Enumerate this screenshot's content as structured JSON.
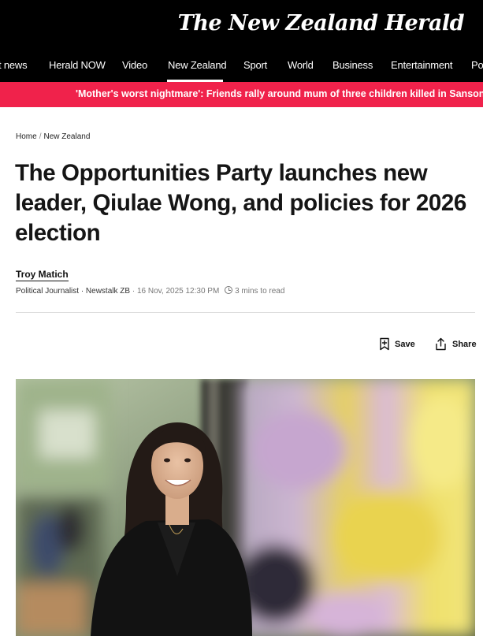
{
  "site": {
    "logo": "The New Zealand Herald"
  },
  "nav": {
    "items": [
      {
        "label": "t news"
      },
      {
        "label": "Herald NOW"
      },
      {
        "label": "Video"
      },
      {
        "label": "New Zealand"
      },
      {
        "label": "Sport"
      },
      {
        "label": "World"
      },
      {
        "label": "Business"
      },
      {
        "label": "Entertainment"
      },
      {
        "label": "Po"
      }
    ],
    "active": "New Zealand"
  },
  "ticker": {
    "text": "'Mother's worst nightmare': Friends rally around mum of three children killed in Sanson fire as"
  },
  "breadcrumb": {
    "home": "Home",
    "separator": "/",
    "section": "New Zealand"
  },
  "article": {
    "headline": "The Opportunities Party launches new leader, Qiulae Wong, and policies for 2026 election",
    "author": "Troy Matich",
    "role": "Political Journalist · Newstalk ZB",
    "separator": "·",
    "date": "16 Nov, 2025 12:30 PM",
    "read_time": "3 mins to read"
  },
  "actions": {
    "save_label": "Save",
    "share_label": "Share"
  },
  "colors": {
    "masthead": "#000000",
    "ticker": "#f0224b",
    "text": "#151515"
  }
}
